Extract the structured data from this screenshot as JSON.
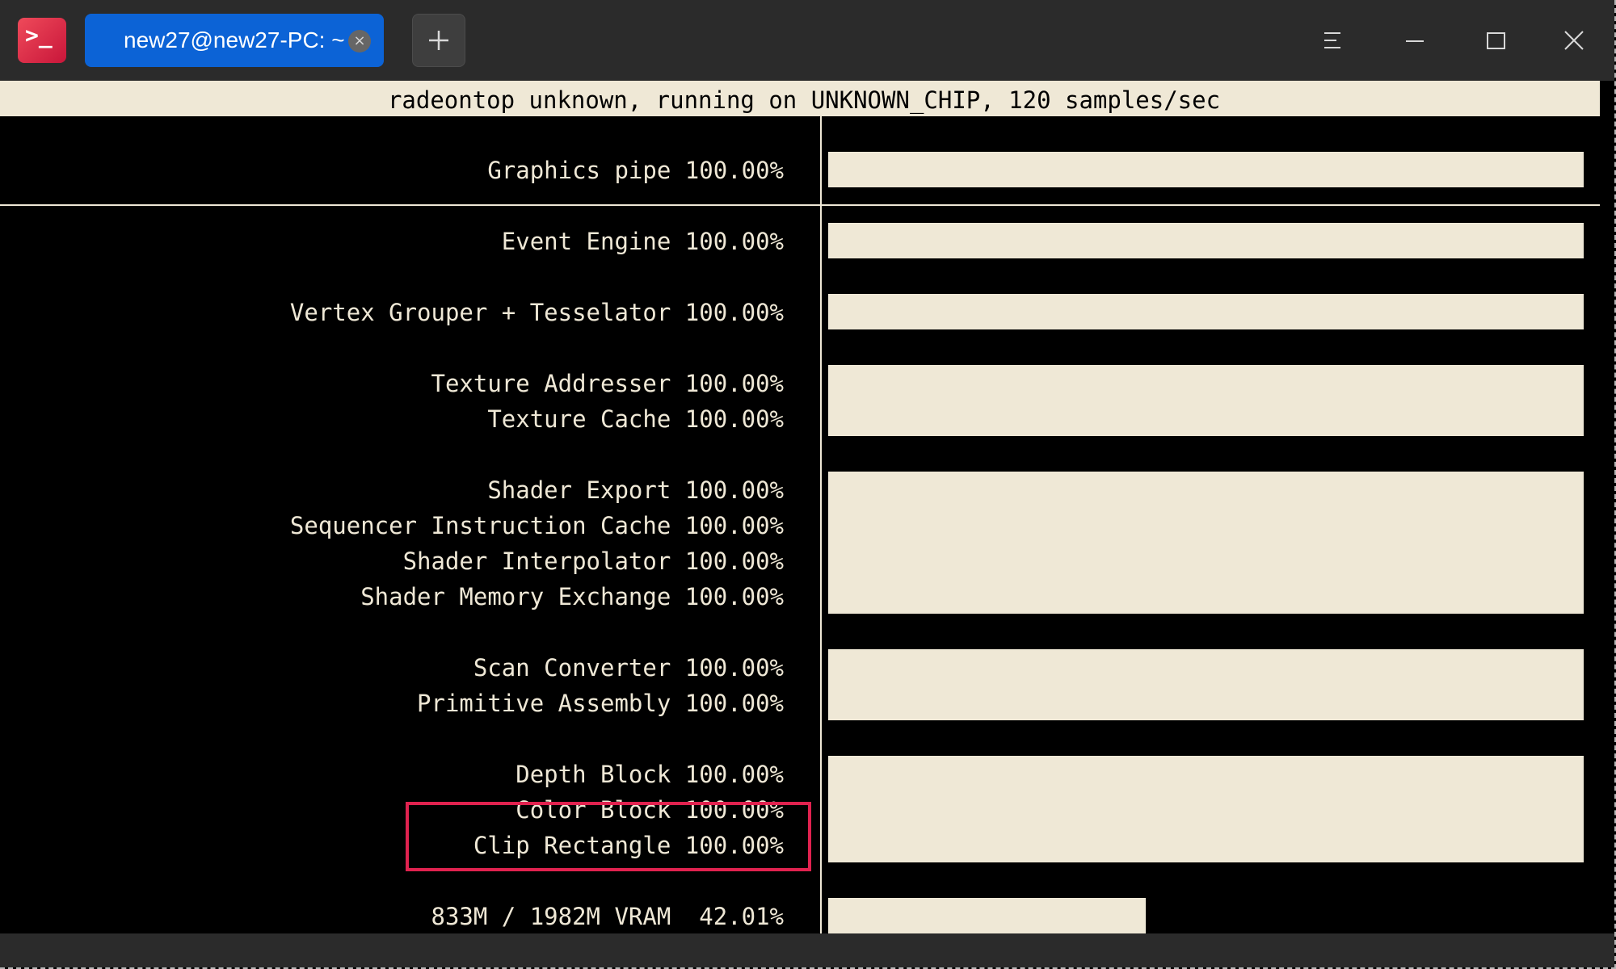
{
  "titlebar": {
    "app_icon_glyph": ">_",
    "tab_title": "new27@new27-PC: ~",
    "tab_close_glyph": "×",
    "new_tab_icon": "plus-icon",
    "menu_icon": "hamburger-menu-icon",
    "minimize_icon": "minimize-icon",
    "maximize_icon": "maximize-icon",
    "close_icon": "close-icon"
  },
  "terminal": {
    "header": "radeontop unknown, running on UNKNOWN_CHIP, 120 samples/sec",
    "metrics": [
      {
        "name": "Graphics pipe",
        "percent": "100.00%",
        "value": 100.0
      },
      {
        "name": "Event Engine",
        "percent": "100.00%",
        "value": 100.0
      },
      {
        "name": "Vertex Grouper + Tesselator",
        "percent": "100.00%",
        "value": 100.0
      },
      {
        "name": "Texture Addresser",
        "percent": "100.00%",
        "value": 100.0
      },
      {
        "name": "Texture Cache",
        "percent": "100.00%",
        "value": 100.0
      },
      {
        "name": "Shader Export",
        "percent": "100.00%",
        "value": 100.0
      },
      {
        "name": "Sequencer Instruction Cache",
        "percent": "100.00%",
        "value": 100.0
      },
      {
        "name": "Shader Interpolator",
        "percent": "100.00%",
        "value": 100.0
      },
      {
        "name": "Shader Memory Exchange",
        "percent": "100.00%",
        "value": 100.0
      },
      {
        "name": "Scan Converter",
        "percent": "100.00%",
        "value": 100.0
      },
      {
        "name": "Primitive Assembly",
        "percent": "100.00%",
        "value": 100.0
      },
      {
        "name": "Depth Block",
        "percent": "100.00%",
        "value": 100.0
      },
      {
        "name": "Color Block",
        "percent": "100.00%",
        "value": 100.0
      },
      {
        "name": "Clip Rectangle",
        "percent": "100.00%",
        "value": 100.0
      }
    ],
    "vram": {
      "text": "833M / 1982M VRAM  42.01%",
      "value": 42.01
    }
  },
  "colors": {
    "terminal_bg": "#000000",
    "terminal_fg": "#efe8d6",
    "tab_active": "#0c63d6",
    "titlebar_bg": "#2b2b2b",
    "highlight": "#e0224f"
  }
}
